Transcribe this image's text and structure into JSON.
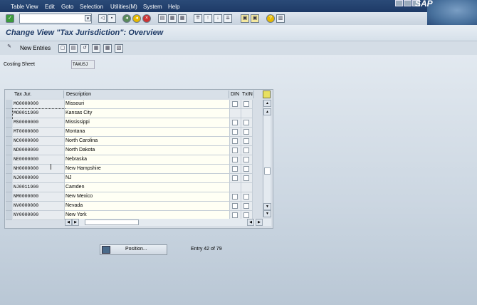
{
  "menu": {
    "items": [
      "Table View",
      "Edit",
      "Goto",
      "Selection",
      "Utilities(M)",
      "System",
      "Help"
    ],
    "logo": "SAP"
  },
  "toolbar": {
    "command_value": ""
  },
  "title": "Change View \"Tax Jurisdiction\": Overview",
  "app_toolbar": {
    "new_entries": "New Entries"
  },
  "costing_sheet": {
    "label": "Costing Sheet",
    "value": "TAXUSJ"
  },
  "table": {
    "columns": [
      "Tax Jur.",
      "Description",
      "DIN",
      "TxIN"
    ],
    "rows": [
      {
        "code": "MO0000000",
        "desc": "Missouri",
        "cb": true
      },
      {
        "code": "MO0011900",
        "desc": "Kansas City",
        "cb": false
      },
      {
        "code": "MS0000000",
        "desc": "Mississippi",
        "cb": true
      },
      {
        "code": "MT0000000",
        "desc": "Montana",
        "cb": true
      },
      {
        "code": "NC0000000",
        "desc": "North Carolina",
        "cb": true
      },
      {
        "code": "ND0000000",
        "desc": "North Dakota",
        "cb": true
      },
      {
        "code": "NE0000000",
        "desc": "Nebraska",
        "cb": true
      },
      {
        "code": "NH0000000",
        "desc": "New Hampshire",
        "cb": true
      },
      {
        "code": "NJ0000000",
        "desc": "NJ",
        "cb": true
      },
      {
        "code": "NJ0011900",
        "desc": "Camden",
        "cb": false
      },
      {
        "code": "NM0000000",
        "desc": "New Mexico",
        "cb": true
      },
      {
        "code": "NV0000000",
        "desc": "Nevada",
        "cb": true
      },
      {
        "code": "NY0000000",
        "desc": "New York",
        "cb": true
      }
    ]
  },
  "position_button": "Position...",
  "entry_info": "Entry 42 of 79"
}
